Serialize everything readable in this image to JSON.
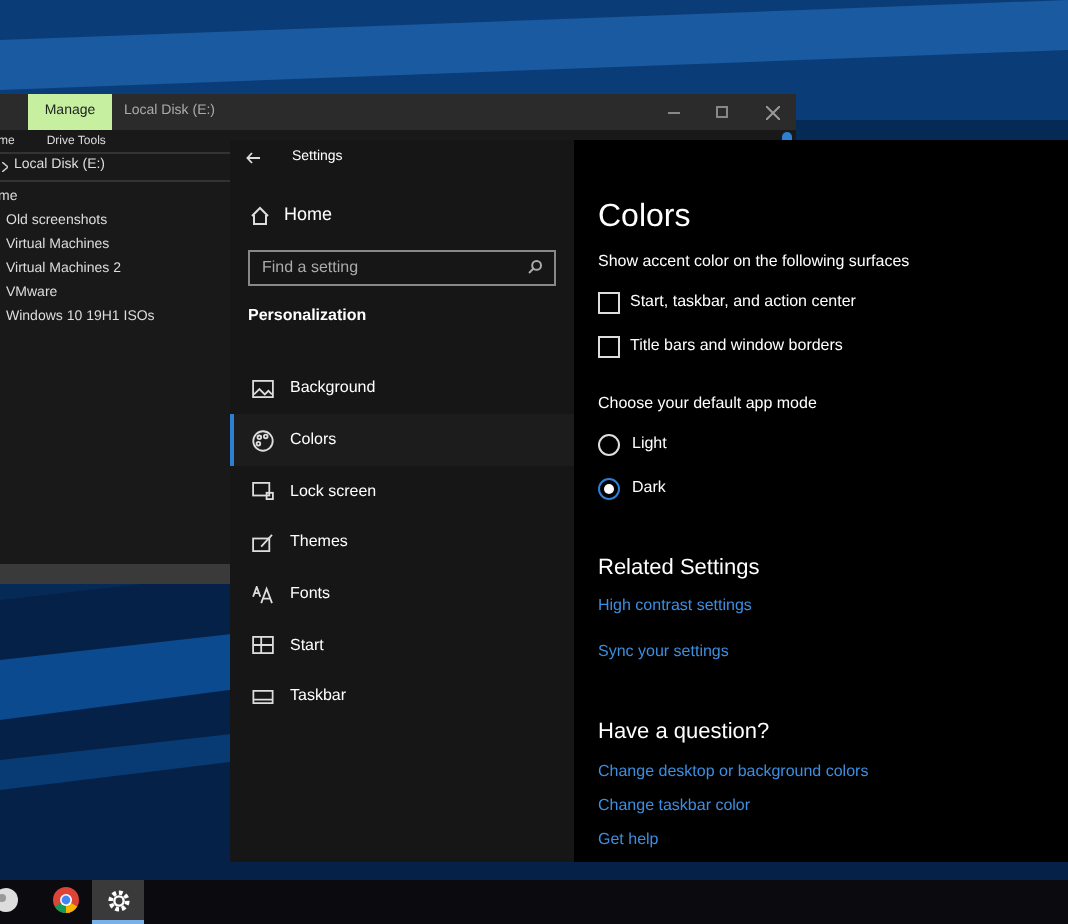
{
  "explorer": {
    "ribbon_tab": "Manage",
    "title": "Local Disk (E:)",
    "ribbon_tabs": [
      "me",
      "Drive Tools"
    ],
    "address": "Local Disk (E:)",
    "column_header": "me",
    "files": [
      "Old screenshots",
      "Virtual Machines",
      "Virtual Machines 2",
      "VMware",
      "Windows 10 19H1 ISOs"
    ]
  },
  "settings": {
    "title": "Settings",
    "home": "Home",
    "search": {
      "placeholder": "Find a setting"
    },
    "section": "Personalization",
    "nav": [
      {
        "label": "Background",
        "selected": false
      },
      {
        "label": "Colors",
        "selected": true
      },
      {
        "label": "Lock screen",
        "selected": false
      },
      {
        "label": "Themes",
        "selected": false
      },
      {
        "label": "Fonts",
        "selected": false
      },
      {
        "label": "Start",
        "selected": false
      },
      {
        "label": "Taskbar",
        "selected": false
      }
    ],
    "content": {
      "heading": "Colors",
      "accent_label": "Show accent color on the following surfaces",
      "checkboxes": [
        {
          "label": "Start, taskbar, and action center",
          "checked": false
        },
        {
          "label": "Title bars and window borders",
          "checked": false
        }
      ],
      "mode_label": "Choose your default app mode",
      "modes": [
        {
          "label": "Light",
          "selected": false
        },
        {
          "label": "Dark",
          "selected": true
        }
      ],
      "related": {
        "heading": "Related Settings",
        "links": [
          "High contrast settings",
          "Sync your settings"
        ]
      },
      "question": {
        "heading": "Have a question?",
        "links": [
          "Change desktop or background colors",
          "Change taskbar color",
          "Get help"
        ]
      }
    }
  },
  "taskbar": {
    "items": [
      {
        "selected": false
      },
      {
        "selected": false
      },
      {
        "selected": true
      }
    ]
  }
}
